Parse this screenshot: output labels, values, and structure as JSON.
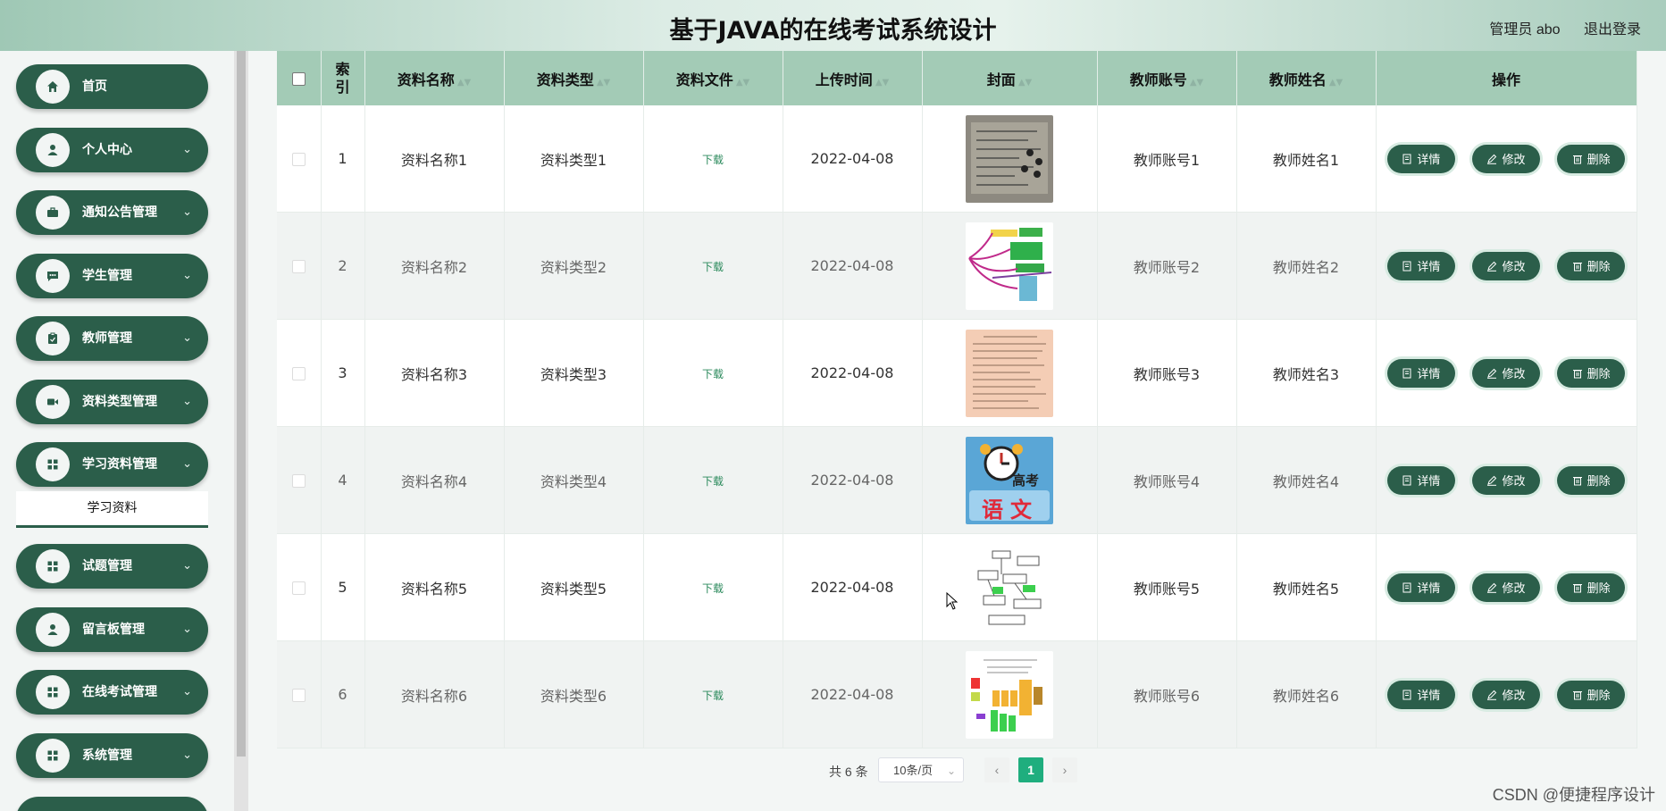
{
  "header": {
    "title": "基于JAVA的在线考试系统设计",
    "user": "管理员 abo",
    "logout": "退出登录"
  },
  "sidebar": {
    "items": [
      {
        "label": "首页",
        "icon": "home-icon",
        "expandable": false
      },
      {
        "label": "个人中心",
        "icon": "user-icon",
        "expandable": true
      },
      {
        "label": "通知公告管理",
        "icon": "briefcase-icon",
        "expandable": true
      },
      {
        "label": "学生管理",
        "icon": "chat-icon",
        "expandable": true
      },
      {
        "label": "教师管理",
        "icon": "clipboard-icon",
        "expandable": true
      },
      {
        "label": "资料类型管理",
        "icon": "video-icon",
        "expandable": true
      },
      {
        "label": "学习资料管理",
        "icon": "grid-icon",
        "expandable": true
      },
      {
        "label": "试题管理",
        "icon": "grid-icon",
        "expandable": true
      },
      {
        "label": "留言板管理",
        "icon": "user-icon",
        "expandable": true
      },
      {
        "label": "在线考试管理",
        "icon": "grid-icon",
        "expandable": true
      },
      {
        "label": "系统管理",
        "icon": "grid-icon",
        "expandable": true
      }
    ],
    "submenu": {
      "label": "学习资料"
    }
  },
  "table": {
    "columns": [
      "",
      "索引",
      "资料名称",
      "资料类型",
      "资料文件",
      "上传时间",
      "封面",
      "教师账号",
      "教师姓名",
      "操作"
    ],
    "rows": [
      {
        "index": "1",
        "name": "资料名称1",
        "type": "资料类型1",
        "file": "下载",
        "time": "2022-04-08",
        "account": "教师账号1",
        "teacher": "教师姓名1"
      },
      {
        "index": "2",
        "name": "资料名称2",
        "type": "资料类型2",
        "file": "下载",
        "time": "2022-04-08",
        "account": "教师账号2",
        "teacher": "教师姓名2"
      },
      {
        "index": "3",
        "name": "资料名称3",
        "type": "资料类型3",
        "file": "下载",
        "time": "2022-04-08",
        "account": "教师账号3",
        "teacher": "教师姓名3"
      },
      {
        "index": "4",
        "name": "资料名称4",
        "type": "资料类型4",
        "file": "下载",
        "time": "2022-04-08",
        "account": "教师账号4",
        "teacher": "教师姓名4"
      },
      {
        "index": "5",
        "name": "资料名称5",
        "type": "资料类型5",
        "file": "下载",
        "time": "2022-04-08",
        "account": "教师账号5",
        "teacher": "教师姓名5"
      },
      {
        "index": "6",
        "name": "资料名称6",
        "type": "资料类型6",
        "file": "下载",
        "time": "2022-04-08",
        "account": "教师账号6",
        "teacher": "教师姓名6"
      }
    ],
    "actions": {
      "detail": "详情",
      "edit": "修改",
      "delete": "删除"
    },
    "cover_texts": {
      "row4_line1": "高考",
      "row4_line2": "语文"
    }
  },
  "pagination": {
    "total": "共 6 条",
    "page_size": "10条/页",
    "current": "1",
    "prev": "‹",
    "next": "›"
  },
  "watermark": "CSDN @便捷程序设计",
  "colors": {
    "primary": "#2b5e4a",
    "header_bg": "#a3cbb6",
    "accent": "#1fae7e"
  }
}
